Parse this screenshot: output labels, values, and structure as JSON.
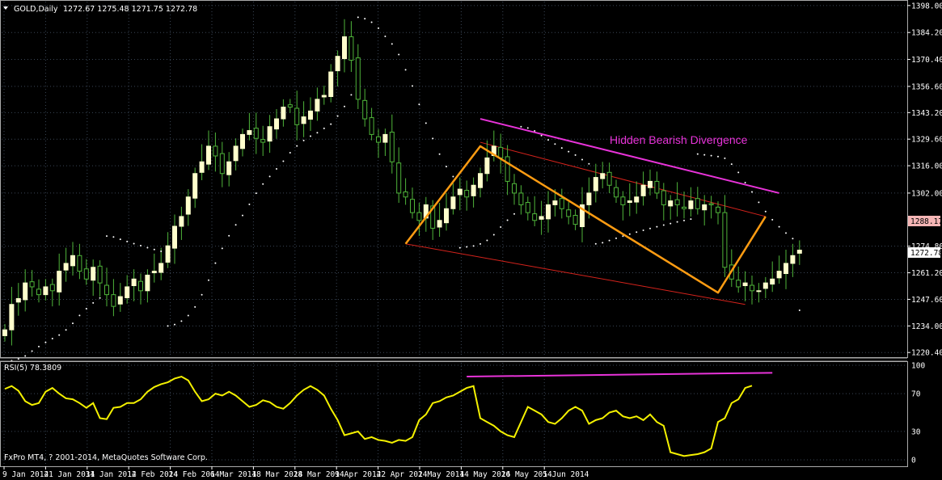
{
  "colors": {
    "background": "#000000",
    "grid": "#3a4656",
    "candle_up": "#ffffcc",
    "candle_down": "#4fb53a",
    "wick": "#4fb53a",
    "psar": "#ffffff",
    "channel": "#d6231c",
    "pattern": "#ff9c12",
    "divergence": "#e833d9",
    "rsi": "#f4f100",
    "bid_tag": "#f5b5b5"
  },
  "header": {
    "symbol_label": "GOLD,Daily",
    "ohlc": "1272.67 1275.48 1271.75 1272.78",
    "dropdown_icon": "triangle-down-icon"
  },
  "annotations": {
    "divergence_text": "Hidden Bearish Divergence"
  },
  "price_axis": {
    "ticks": [
      "1398.00",
      "1384.20",
      "1370.40",
      "1356.60",
      "1343.20",
      "1329.60",
      "1316.00",
      "1302.00",
      "1274.80",
      "1261.20",
      "1247.60",
      "1234.00",
      "1220.40"
    ],
    "tag_upper": "1288.17",
    "tag_current": "1272.78"
  },
  "rsi_panel": {
    "label": "RSI(5) 78.3809",
    "ticks": [
      "100",
      "70",
      "30",
      "0"
    ]
  },
  "copyright": "FxPro MT4, ? 2001-2014, MetaQuotes Software Corp.",
  "time_axis": {
    "labels": [
      "9 Jan 2014",
      "21 Jan 2014",
      "31 Jan 2014",
      "12 Feb 2014",
      "24 Feb 2014",
      "6 Mar 2014",
      "18 Mar 2014",
      "28 Mar 2014",
      "9 Apr 2014",
      "22 Apr 2014",
      "2 May 2014",
      "14 May 2014",
      "26 May 2014",
      "5 Jun 2014"
    ]
  },
  "chart_data": {
    "type": "candlestick",
    "title": "GOLD,Daily",
    "ylim": [
      1218,
      1400
    ],
    "x_start": "2014-01-06",
    "closes": [
      1232,
      1245,
      1248,
      1256,
      1254,
      1250,
      1254,
      1252,
      1262,
      1266,
      1270,
      1262,
      1258,
      1264,
      1256,
      1250,
      1244,
      1249,
      1254,
      1258,
      1252,
      1260,
      1262,
      1266,
      1275,
      1285,
      1290,
      1300,
      1312,
      1318,
      1326,
      1321,
      1312,
      1318,
      1326,
      1332,
      1334,
      1330,
      1328,
      1336,
      1340,
      1346,
      1346,
      1337,
      1341,
      1344,
      1350,
      1352,
      1364,
      1372,
      1382,
      1370,
      1350,
      1340,
      1332,
      1328,
      1332,
      1318,
      1302,
      1300,
      1292,
      1288,
      1296,
      1284,
      1288,
      1294,
      1300,
      1304,
      1300,
      1306,
      1312,
      1320,
      1326,
      1320,
      1308,
      1302,
      1296,
      1292,
      1288,
      1290,
      1296,
      1298,
      1294,
      1290,
      1286,
      1296,
      1302,
      1310,
      1312,
      1306,
      1300,
      1296,
      1298,
      1300,
      1306,
      1308,
      1302,
      1296,
      1298,
      1296,
      1294,
      1298,
      1294,
      1296,
      1296,
      1292,
      1264,
      1258,
      1254,
      1256,
      1252,
      1252,
      1256,
      1258,
      1262,
      1266,
      1270,
      1272.78
    ],
    "psar_note": "parabolic SAR dots shown above/below candles",
    "channel": {
      "upper": [
        [
          "2014-04-14",
          1328
        ],
        [
          "2014-06-11",
          1290
        ]
      ],
      "lower": [
        [
          "2014-03-28",
          1276
        ],
        [
          "2014-06-06",
          1245
        ]
      ]
    },
    "pattern": [
      [
        "2014-03-28",
        1276
      ],
      [
        "2014-04-14",
        1326
      ],
      [
        "2014-06-02",
        1251
      ],
      [
        "2014-06-11",
        1290
      ]
    ],
    "divergence_line": [
      [
        "2014-04-14",
        1340
      ],
      [
        "2014-06-13",
        1302
      ]
    ],
    "rsi": {
      "name": "RSI(5)",
      "last": 78.3809,
      "ylim": [
        0,
        100
      ],
      "values": [
        75,
        78,
        73,
        62,
        58,
        60,
        72,
        76,
        70,
        65,
        64,
        60,
        55,
        60,
        44,
        43,
        55,
        56,
        60,
        60,
        64,
        72,
        77,
        80,
        82,
        86,
        88,
        84,
        72,
        62,
        64,
        70,
        68,
        72,
        68,
        62,
        56,
        58,
        63,
        61,
        56,
        54,
        60,
        68,
        74,
        78,
        74,
        68,
        54,
        42,
        26,
        28,
        30,
        22,
        24,
        21,
        20,
        18,
        21,
        20,
        24,
        42,
        48,
        60,
        62,
        66,
        68,
        72,
        76,
        78,
        44,
        40,
        36,
        30,
        26,
        24,
        40,
        56,
        52,
        48,
        40,
        38,
        44,
        52,
        56,
        52,
        38,
        42,
        44,
        50,
        52,
        46,
        44,
        46,
        42,
        48,
        40,
        36,
        8,
        6,
        4,
        5,
        6,
        8,
        12,
        40,
        44,
        60,
        64,
        76,
        78.38
      ],
      "divergence_line": [
        [
          "2014-04-10",
          88
        ],
        [
          "2014-06-12",
          92
        ]
      ]
    }
  }
}
